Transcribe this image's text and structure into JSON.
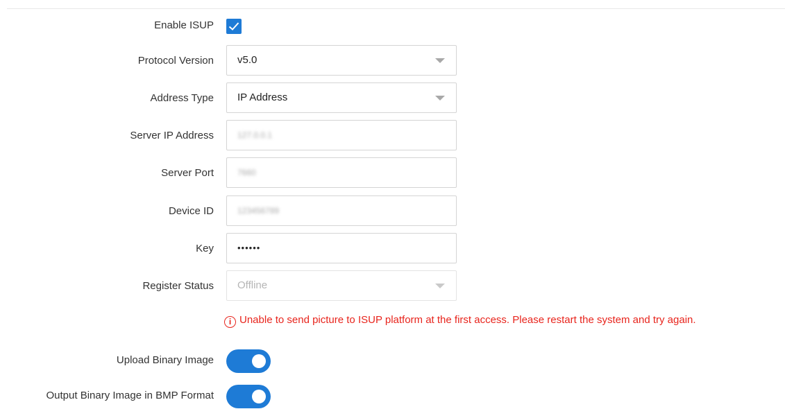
{
  "form": {
    "enable_isup": {
      "label": "Enable ISUP",
      "checked": true
    },
    "protocol_version": {
      "label": "Protocol Version",
      "value": "v5.0"
    },
    "address_type": {
      "label": "Address Type",
      "value": "IP Address"
    },
    "server_ip": {
      "label": "Server IP Address",
      "value": "127.0.0.1"
    },
    "server_port": {
      "label": "Server Port",
      "value": "7660"
    },
    "device_id": {
      "label": "Device ID",
      "value": "123456789"
    },
    "key": {
      "label": "Key",
      "value": "••••••"
    },
    "register_status": {
      "label": "Register Status",
      "value": "Offline"
    },
    "notice": "Unable to send picture to ISUP platform at the first access. Please restart the system and try again.",
    "notice_icon": "i",
    "upload_binary_image": {
      "label": "Upload Binary Image",
      "on": true
    },
    "output_bmp": {
      "label": "Output Binary Image in BMP Format",
      "on": true
    }
  },
  "colors": {
    "accent": "#1e7bd6",
    "error": "#e8241c"
  },
  "icons": {
    "checkbox": "checkmark-icon",
    "dropdown": "caret-down-icon",
    "notice": "info-circle-icon"
  }
}
